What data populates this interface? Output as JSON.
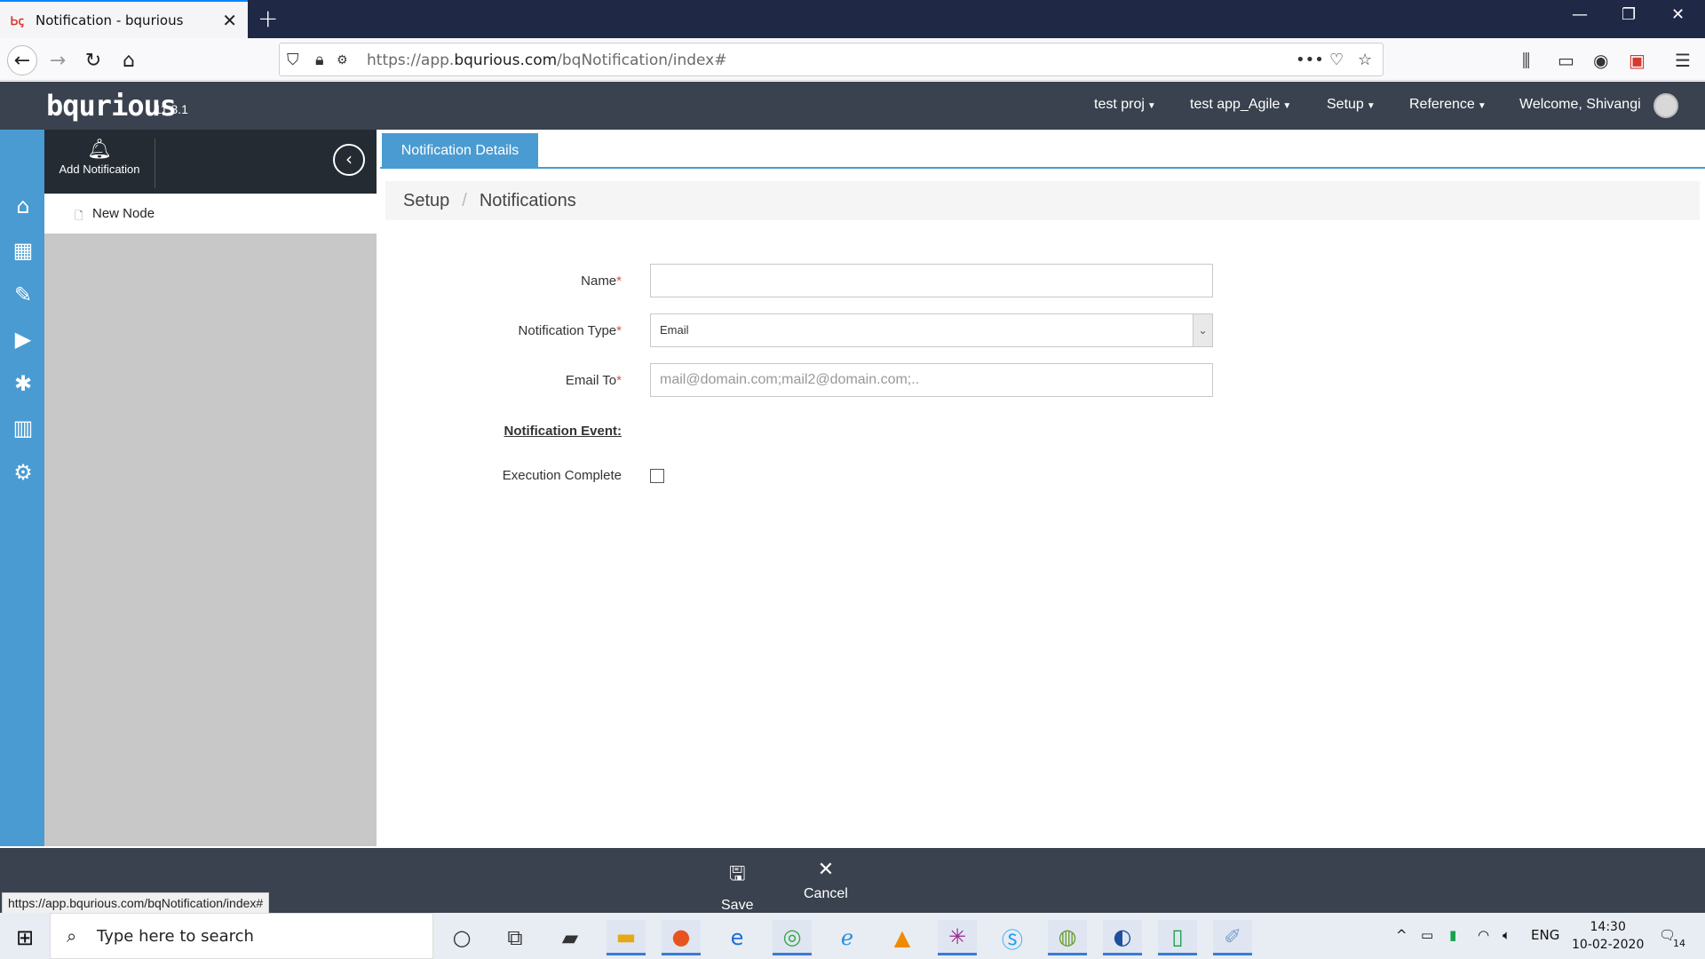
{
  "browser": {
    "tab_title": "Notification - bqurious",
    "new_tab": "+",
    "url_prefix": "https://app.",
    "url_domain": "bqurious.com",
    "url_path": "/bqNotification/index#",
    "status_url": "https://app.bqurious.com/bqNotification/index#"
  },
  "app": {
    "logo": "bqurious",
    "version": "11.8.1",
    "menu": [
      "test proj",
      "test app_Agile",
      "Setup",
      "Reference"
    ],
    "welcome": "Welcome, Shivangi"
  },
  "rail": {
    "icons": [
      "home-icon",
      "calendar-icon",
      "pencil-icon",
      "play-icon",
      "bug-icon",
      "bar-chart-icon",
      "settings-icon"
    ]
  },
  "tree": {
    "add_label": "Add Notification",
    "nodes": [
      "New Node"
    ]
  },
  "main": {
    "tab": "Notification Details",
    "breadcrumb": [
      "Setup",
      "Notifications"
    ],
    "form": {
      "name_label": "Name",
      "name_value": "",
      "type_label": "Notification Type",
      "type_value": "Email",
      "email_label": "Email To",
      "email_placeholder": "mail@domain.com;mail2@domain.com;..",
      "event_section": "Notification Event:",
      "event_exec_label": "Execution Complete",
      "required_mark": "*"
    }
  },
  "footer": {
    "save": "Save",
    "cancel": "Cancel"
  },
  "taskbar": {
    "search_placeholder": "Type here to search",
    "language": "ENG",
    "time": "14:30",
    "date": "10-02-2020",
    "notification_count": "14"
  }
}
